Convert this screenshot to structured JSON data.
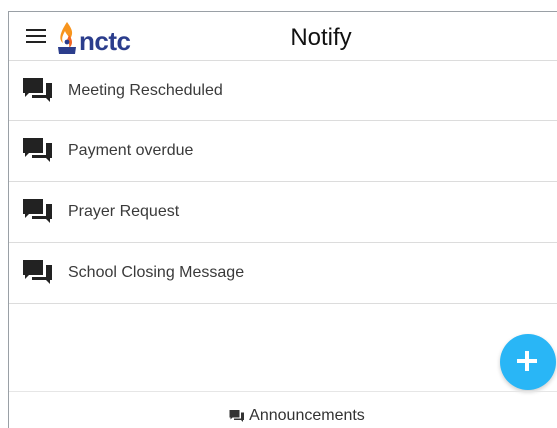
{
  "header": {
    "logo_text": "nctc",
    "title": "Notify"
  },
  "notifications": [
    {
      "label": "Meeting Rescheduled",
      "icon": "chat-icon"
    },
    {
      "label": "Payment overdue",
      "icon": "chat-icon"
    },
    {
      "label": "Prayer Request",
      "icon": "chat-icon"
    },
    {
      "label": "School Closing Message",
      "icon": "chat-icon"
    }
  ],
  "fab": {
    "icon": "plus-icon",
    "color": "#29b6f6"
  },
  "footer": {
    "label": "Announcements",
    "icon": "chat-icon"
  },
  "colors": {
    "brand_blue": "#2b3d8c",
    "brand_orange": "#f7941d",
    "accent": "#29b6f6"
  }
}
